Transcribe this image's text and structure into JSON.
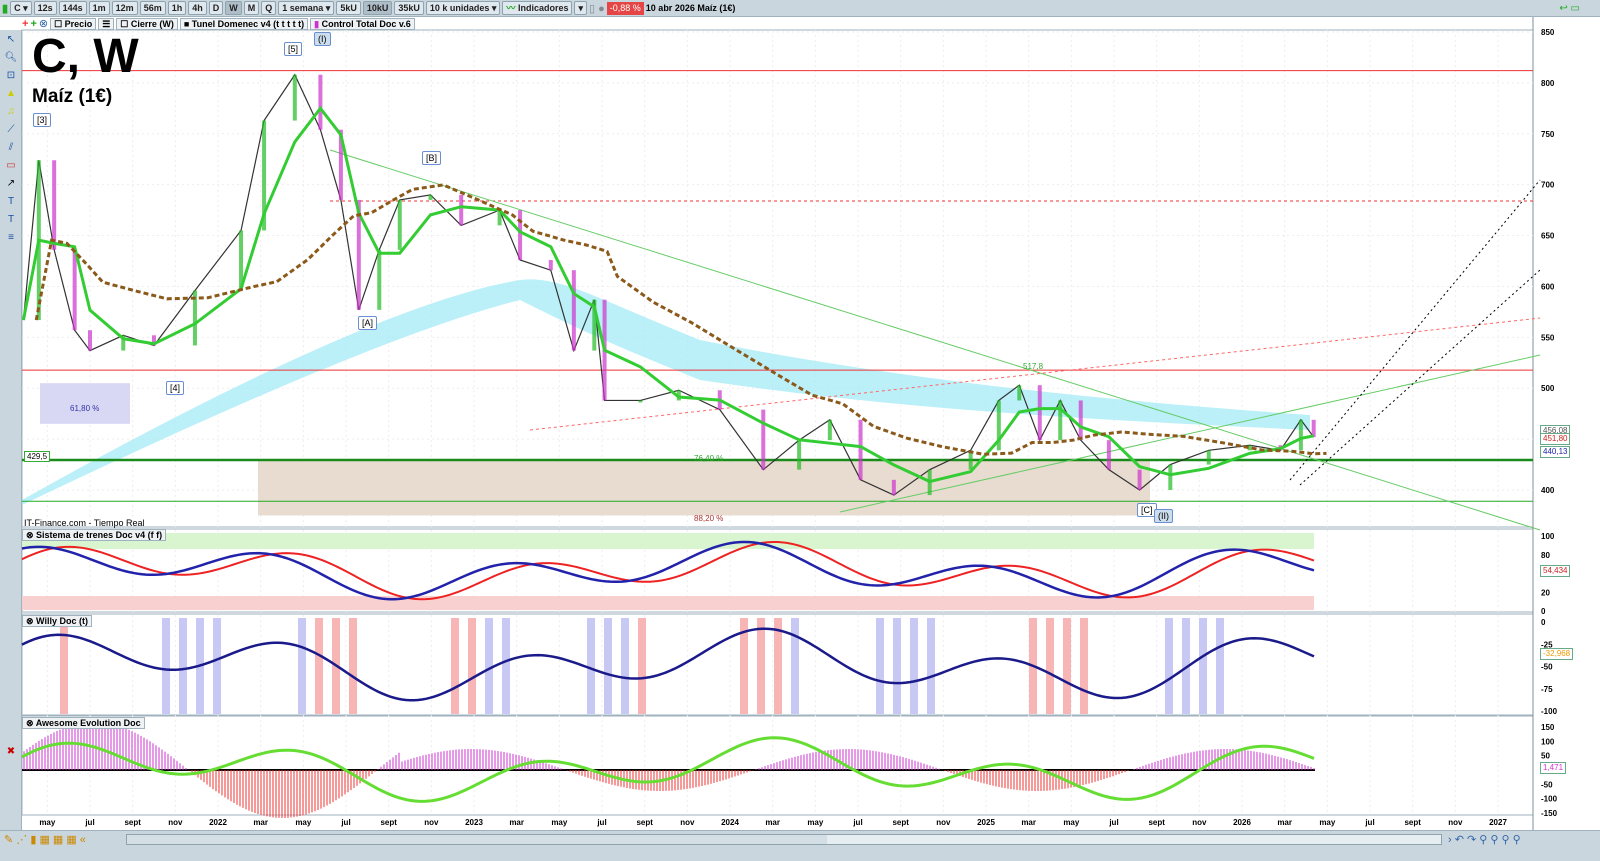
{
  "toolbar": {
    "symbol": "C",
    "intervals": [
      "12s",
      "144s",
      "1m",
      "12m",
      "56m",
      "1h",
      "4h",
      "D",
      "W",
      "M",
      "Q"
    ],
    "active_interval": "W",
    "period": "1 semana",
    "units": [
      "5kU",
      "10kU",
      "35kU"
    ],
    "active_unit": "10kU",
    "units_select": "10 k unidades",
    "indicators": "Indicadores",
    "change": "-0,88 %",
    "date_info": "10 abr 2026 Maíz (1€)"
  },
  "legend": [
    "Precio",
    "Cierre (W)",
    "Tunel Domenec v4 (t t t t t)",
    "Control Total Doc v.6"
  ],
  "chart": {
    "title": "C, W",
    "subtitle": "Maíz (1€)",
    "source": "IT-Finance.com - Tiempo Real",
    "wave_labels": {
      "w3": "[3]",
      "w5": "[5]",
      "wI": "(I)",
      "wB": "[B]",
      "wA": "[A]",
      "w4": "[4]",
      "wC": "[C]",
      "wII": "(II)"
    },
    "annotations": {
      "fib618": "61,80 %",
      "fib764": "76,40 %",
      "fib882": "88,20 %",
      "lvl4295": "429,5",
      "lvl5178": "517,8"
    },
    "price_labels": {
      "p1": "456,08",
      "p2": "451,80",
      "p3": "440,13"
    }
  },
  "chart_data": {
    "type": "line",
    "title": "C, W",
    "ylim": [
      375,
      855
    ],
    "yticks": [
      "850",
      "800",
      "750",
      "700",
      "650",
      "600",
      "550",
      "500",
      "450",
      "400"
    ],
    "xticks": [
      "may",
      "jul",
      "sept",
      "nov",
      "2022",
      "mar",
      "may",
      "jul",
      "sept",
      "nov",
      "2023",
      "mar",
      "may",
      "jul",
      "sept",
      "nov",
      "2024",
      "mar",
      "may",
      "jul",
      "sept",
      "nov",
      "2025",
      "mar",
      "may",
      "jul",
      "sept",
      "nov",
      "2026",
      "mar",
      "may",
      "jul",
      "sept",
      "nov",
      "2027"
    ],
    "series": [
      {
        "name": "Precio",
        "points": [
          [
            2021.24,
            567
          ],
          [
            2021.3,
            724
          ],
          [
            2021.36,
            636
          ],
          [
            2021.44,
            557
          ],
          [
            2021.5,
            537
          ],
          [
            2021.63,
            552
          ],
          [
            2021.75,
            542
          ],
          [
            2021.91,
            596
          ],
          [
            2022.09,
            655
          ],
          [
            2022.18,
            763
          ],
          [
            2022.3,
            808
          ],
          [
            2022.4,
            754
          ],
          [
            2022.48,
            685
          ],
          [
            2022.55,
            577
          ],
          [
            2022.63,
            636
          ],
          [
            2022.71,
            685
          ],
          [
            2022.83,
            690
          ],
          [
            2022.95,
            660
          ],
          [
            2023.1,
            675
          ],
          [
            2023.18,
            626
          ],
          [
            2023.3,
            616
          ],
          [
            2023.39,
            537
          ],
          [
            2023.47,
            587
          ],
          [
            2023.51,
            488
          ],
          [
            2023.65,
            488
          ],
          [
            2023.8,
            498
          ],
          [
            2023.96,
            479
          ],
          [
            2024.13,
            420
          ],
          [
            2024.27,
            449
          ],
          [
            2024.39,
            469
          ],
          [
            2024.51,
            410
          ],
          [
            2024.64,
            395
          ],
          [
            2024.78,
            420
          ],
          [
            2024.94,
            439
          ],
          [
            2025.05,
            488
          ],
          [
            2025.13,
            503
          ],
          [
            2025.21,
            449
          ],
          [
            2025.29,
            488
          ],
          [
            2025.37,
            449
          ],
          [
            2025.48,
            420
          ],
          [
            2025.6,
            400
          ],
          [
            2025.72,
            425
          ],
          [
            2025.87,
            439
          ],
          [
            2026.03,
            444
          ],
          [
            2026.15,
            439
          ],
          [
            2026.23,
            469
          ],
          [
            2026.28,
            452
          ]
        ]
      }
    ],
    "hlines": [
      {
        "value": 812,
        "color": "#e33"
      },
      {
        "value": 517.8,
        "color": "#e33"
      },
      {
        "value": 684,
        "color": "#e33",
        "dash": true
      },
      {
        "value": 429.5,
        "color": "#1a8a1a",
        "thick": true
      },
      {
        "value": 389,
        "color": "#2a2"
      }
    ]
  },
  "osc1": {
    "title": "Sistema de trenes Doc v4 (f f)",
    "ticks": [
      "100",
      "80",
      "50",
      "20",
      "0"
    ],
    "value": "54,434"
  },
  "osc2": {
    "title": "Willy Doc (t)",
    "ticks": [
      "0",
      "-25",
      "-50",
      "-75",
      "-100"
    ],
    "value": "-32,968"
  },
  "osc3": {
    "title": "Awesome Evolution Doc",
    "ticks": [
      "150",
      "100",
      "50",
      "0",
      "-50",
      "-100",
      "-150"
    ],
    "value": "1,471"
  }
}
